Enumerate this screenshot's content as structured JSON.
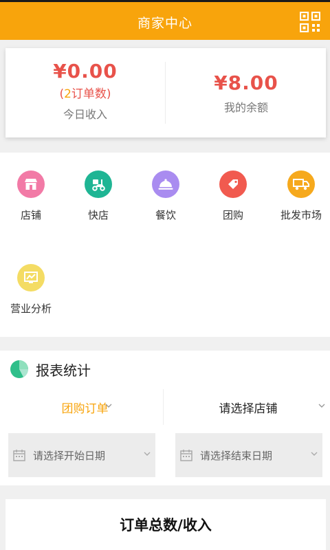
{
  "header": {
    "title": "商家中心",
    "qr_icon": "qr-code-icon"
  },
  "stats": {
    "today_income": "¥0.00",
    "order_prefix": "(",
    "order_num": "2",
    "order_suffix": "订单数)",
    "today_label": "今日收入",
    "balance": "¥8.00",
    "balance_label": "我的余额"
  },
  "menu": {
    "items": [
      {
        "label": "店铺",
        "icon": "store-icon",
        "color": "#f27aa6"
      },
      {
        "label": "快店",
        "icon": "scooter-icon",
        "color": "#1fb594"
      },
      {
        "label": "餐饮",
        "icon": "dish-cover-icon",
        "color": "#a98cf0"
      },
      {
        "label": "团购",
        "icon": "tag-icon",
        "color": "#f15a4f"
      },
      {
        "label": "批发市场",
        "icon": "truck-icon",
        "color": "#f6a91d"
      },
      {
        "label": "营业分析",
        "icon": "analytics-icon",
        "color": "#f4dc64"
      }
    ]
  },
  "report": {
    "title": "报表统计",
    "order_type": "团购订单",
    "store_select": "请选择店铺",
    "start_date_placeholder": "请选择开始日期",
    "end_date_placeholder": "请选择结束日期",
    "accent": "#f8a40c"
  },
  "summary": {
    "title": "订单总数/收入"
  }
}
